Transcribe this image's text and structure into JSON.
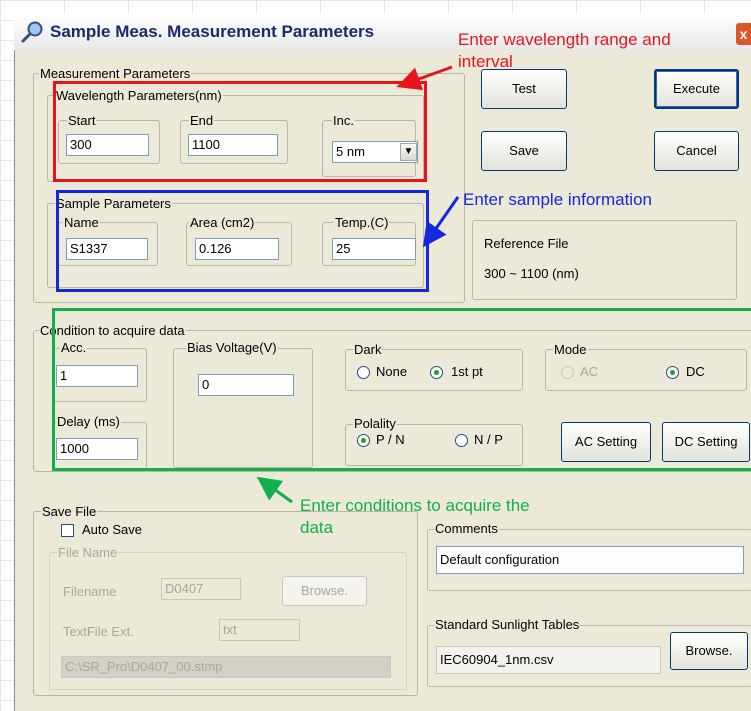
{
  "window": {
    "title": "Sample Meas. Measurement Parameters",
    "close_glyph": "x"
  },
  "measurement": {
    "group_label": "Measurement Parameters",
    "wavelength": {
      "group_label": "Wavelength Parameters(nm)",
      "start": {
        "label": "Start",
        "value": "300"
      },
      "end": {
        "label": "End",
        "value": "1100"
      },
      "inc": {
        "label": "Inc.",
        "value": "5 nm"
      }
    },
    "sample": {
      "group_label": "Sample Parameters",
      "name": {
        "label": "Name",
        "value": "S1337"
      },
      "area": {
        "label": "Area (cm2)",
        "value": "0.126"
      },
      "temp": {
        "label": "Temp.(C)",
        "value": "25"
      }
    },
    "reference": {
      "title": "Reference File",
      "range": "300 ~ 1100 (nm)"
    }
  },
  "buttons": {
    "test": "Test",
    "execute": "Execute",
    "save": "Save",
    "cancel": "Cancel",
    "ac_setting": "AC Setting",
    "dc_setting": "DC Setting",
    "browse_file": "Browse.",
    "browse_tables": "Browse."
  },
  "condition": {
    "group_label": "Condition to acquire data",
    "acc": {
      "label": "Acc.",
      "value": "1"
    },
    "delay": {
      "label": "Delay (ms)",
      "value": "1000"
    },
    "bias": {
      "label": "Bias Voltage(V)",
      "value": "0"
    },
    "dark": {
      "label": "Dark",
      "none": "None",
      "first": "1st pt",
      "selected": "1st pt"
    },
    "mode": {
      "label": "Mode",
      "ac": "AC",
      "dc": "DC",
      "selected": "DC"
    },
    "polarity": {
      "label": "Polality",
      "pn": "P / N",
      "np": "N / P",
      "selected": "P / N"
    }
  },
  "save_file": {
    "group_label": "Save File",
    "auto_save": {
      "label": "Auto Save",
      "checked": false
    },
    "file_name": {
      "group_label": "File Name",
      "filename_label": "Filename",
      "filename_value": "D0407",
      "textfile_label": "TextFile Ext.",
      "textfile_value": "txt",
      "path": "C:\\SR_Pro\\D0407_00.stmp"
    }
  },
  "comments": {
    "group_label": "Comments",
    "value": "Default configuration"
  },
  "sunlight": {
    "group_label": "Standard Sunlight Tables",
    "value": "IEC60904_1nm.csv"
  },
  "annotations": {
    "wavelength_line1": "Enter wavelength range and",
    "wavelength_line2": "interval",
    "sample": "Enter sample information",
    "conditions_line1": "Enter conditions to acquire the",
    "conditions_line2": "data"
  },
  "colors": {
    "red": "#e8141c",
    "blue": "#1428e0",
    "green": "#12b04a",
    "title_text": "#1d2a6a"
  }
}
